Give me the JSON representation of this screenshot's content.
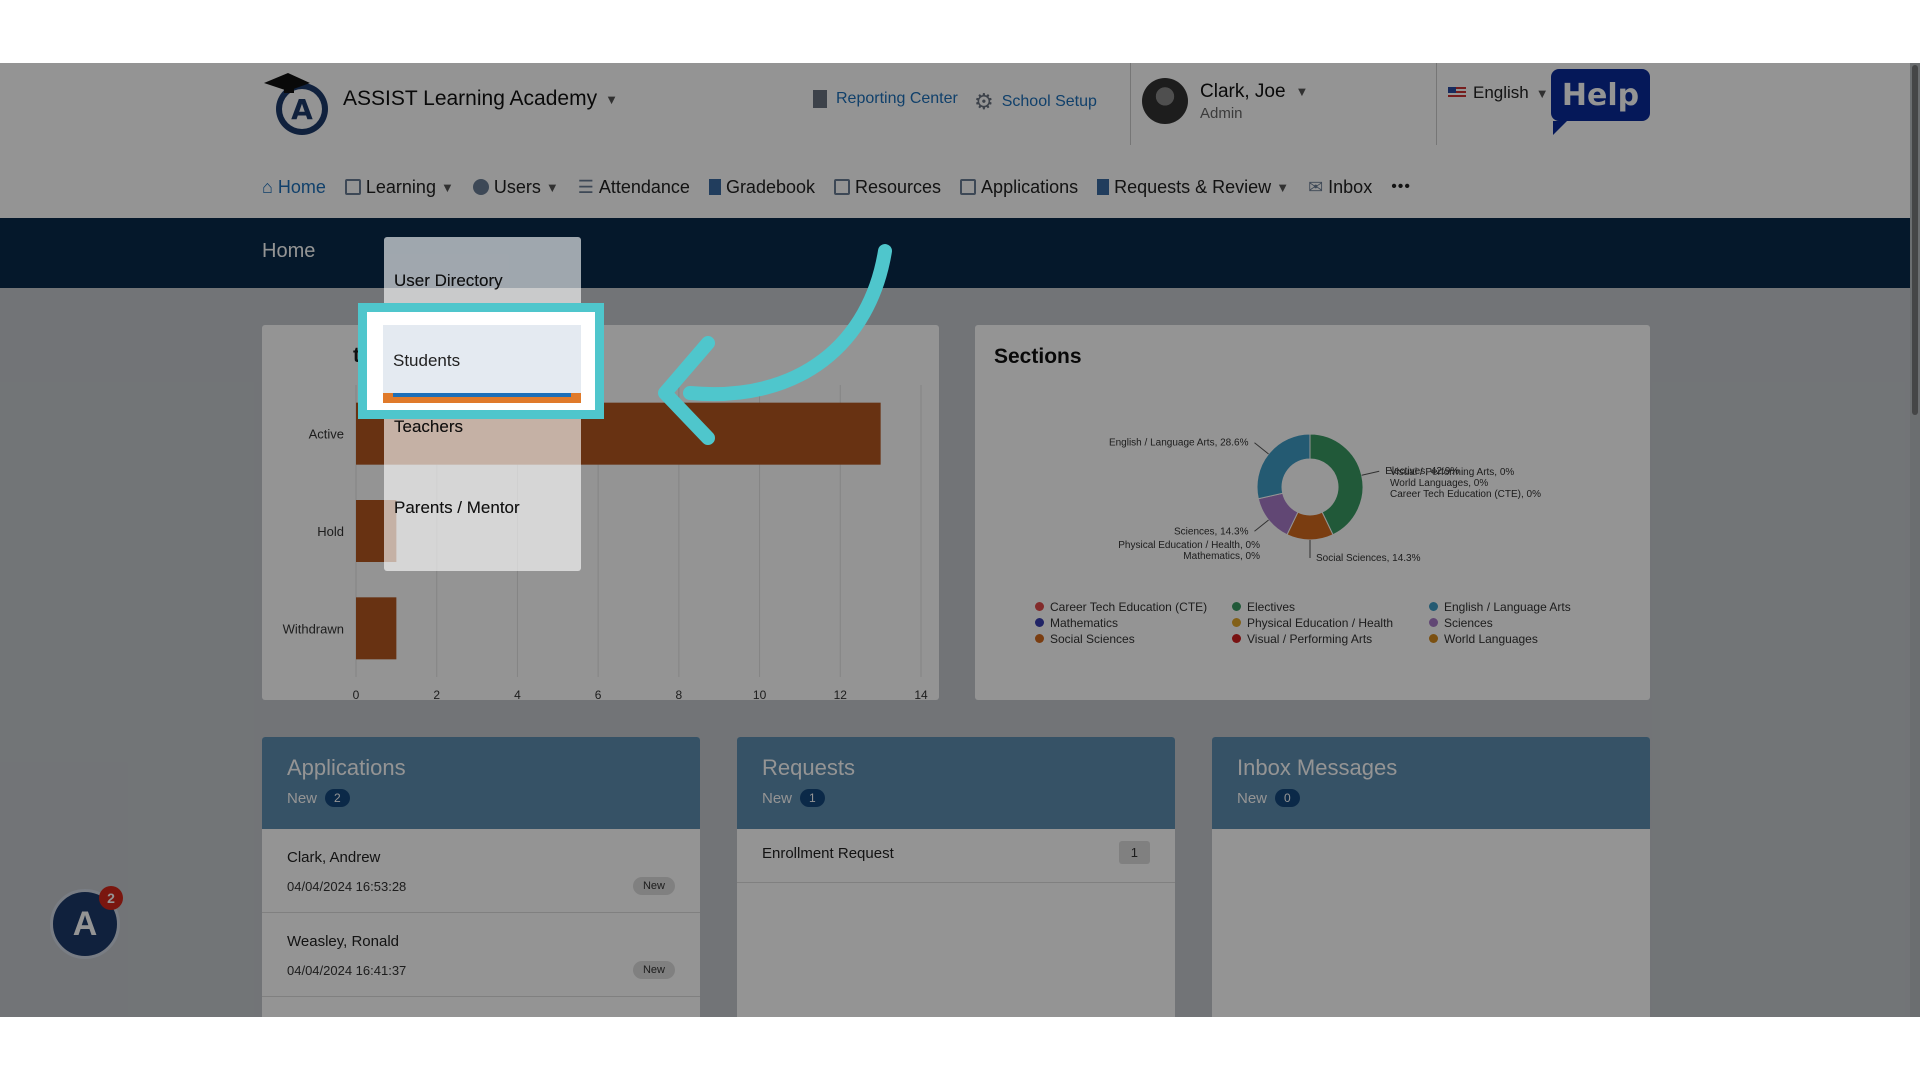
{
  "header": {
    "school_name": "ASSIST Learning Academy",
    "reporting_center": "Reporting Center",
    "school_setup": "School Setup",
    "user_name": "Clark, Joe",
    "user_role": "Admin",
    "language": "English",
    "help": "Help"
  },
  "nav": {
    "home": "Home",
    "learning": "Learning",
    "users": "Users",
    "attendance": "Attendance",
    "gradebook": "Gradebook",
    "resources": "Resources",
    "applications": "Applications",
    "requests_review": "Requests & Review",
    "inbox": "Inbox",
    "more": "•••"
  },
  "page_title": "Home",
  "users_menu": {
    "items": [
      "User Directory",
      "Students",
      "Teachers",
      "Parents / Mentor"
    ]
  },
  "students_chart": {
    "title_fragment": "tu",
    "chart_data": {
      "type": "bar",
      "categories": [
        "Active",
        "Hold",
        "Withdrawn"
      ],
      "values": [
        13,
        1,
        1
      ],
      "xlim": [
        0,
        14
      ],
      "xticks": [
        0,
        2,
        4,
        6,
        8,
        10,
        12,
        14
      ],
      "bar_color": "#b3561f"
    }
  },
  "sections_chart": {
    "title": "Sections",
    "chart_data": {
      "type": "pie",
      "slices": [
        {
          "name": "Electives",
          "value": 42.9,
          "color": "#3a9a63",
          "label": "Electives, 42.9%"
        },
        {
          "name": "Social Sciences",
          "value": 14.3,
          "color": "#d2691e",
          "label": "Social Sciences, 14.3%"
        },
        {
          "name": "Sciences",
          "value": 14.3,
          "color": "#a77ac9",
          "label": "Sciences, 14.3%"
        },
        {
          "name": "English / Language Arts",
          "value": 28.6,
          "color": "#3f9cc5",
          "label": "English / Language Arts, 28.6%"
        }
      ],
      "zero_labels": [
        "Visual / Performing Arts, 0%",
        "World Languages, 0%",
        "Career Tech Education (CTE), 0%",
        "Physical Education / Health, 0%",
        "Mathematics, 0%"
      ],
      "legend": [
        {
          "name": "Career Tech Education (CTE)",
          "color": "#e04b4b"
        },
        {
          "name": "Electives",
          "color": "#3a9a63"
        },
        {
          "name": "English / Language Arts",
          "color": "#3f9cc5"
        },
        {
          "name": "Mathematics",
          "color": "#3a3fb0"
        },
        {
          "name": "Physical Education / Health",
          "color": "#e0a52a"
        },
        {
          "name": "Sciences",
          "color": "#a77ac9"
        },
        {
          "name": "Social Sciences",
          "color": "#d2691e"
        },
        {
          "name": "Visual / Performing Arts",
          "color": "#d01f1f"
        },
        {
          "name": "World Languages",
          "color": "#d48a1e"
        }
      ]
    }
  },
  "applications": {
    "title": "Applications",
    "new_label": "New",
    "new_count": "2",
    "rows": [
      {
        "name": "Clark, Andrew",
        "date": "04/04/2024 16:53:28",
        "tag": "New"
      },
      {
        "name": "Weasley, Ronald",
        "date": "04/04/2024 16:41:37",
        "tag": "New"
      }
    ]
  },
  "requests": {
    "title": "Requests",
    "new_label": "New",
    "new_count": "1",
    "rows": [
      {
        "name": "Enrollment Request",
        "count": "1"
      }
    ]
  },
  "inbox": {
    "title": "Inbox Messages",
    "new_label": "New",
    "new_count": "0"
  },
  "assistant_badge": "2",
  "colors": {
    "accent": "#1d6fb8",
    "highlight": "#4fc6cc",
    "homebar": "#0a2a4a"
  }
}
